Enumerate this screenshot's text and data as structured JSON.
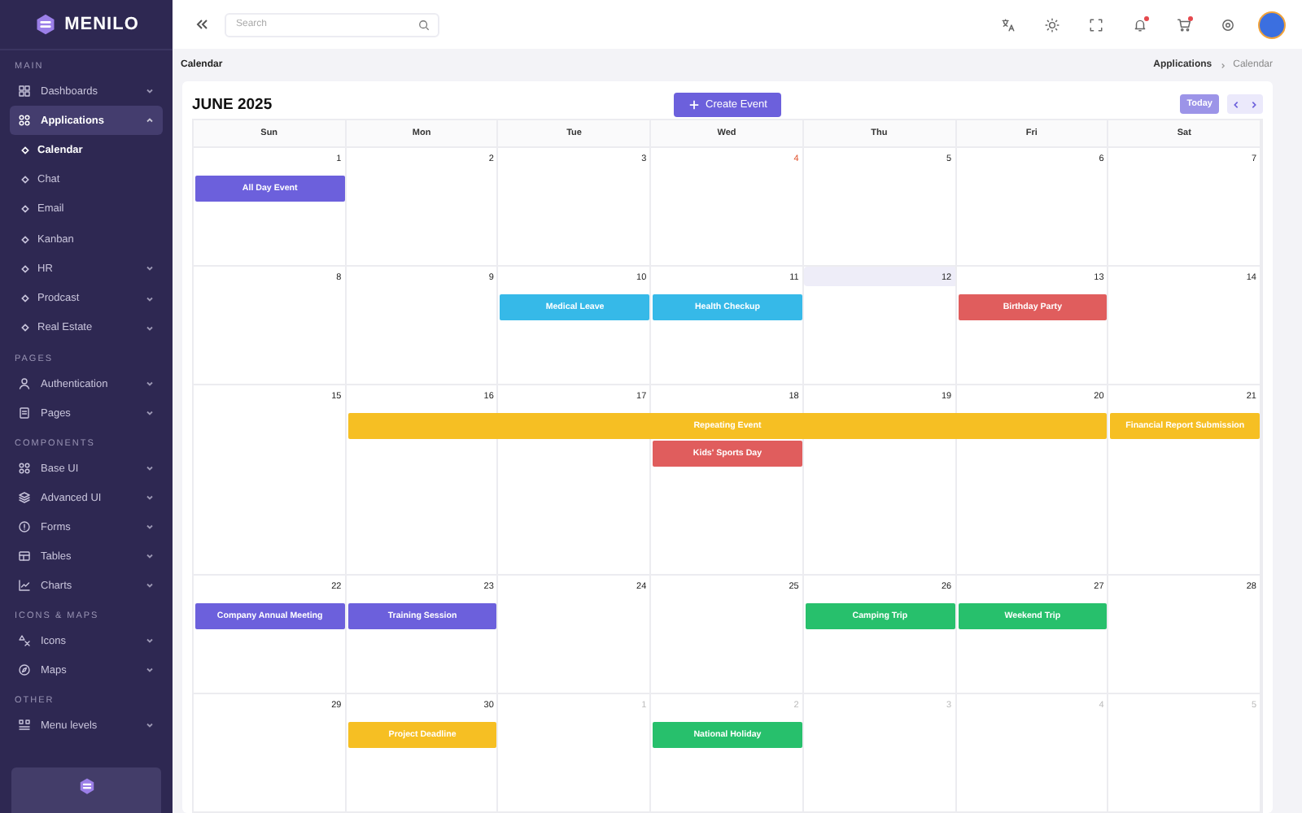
{
  "brand": {
    "name": "MENILO"
  },
  "sidebar": {
    "sections": [
      {
        "title": "MAIN",
        "items": [
          {
            "label": "Dashboards",
            "expandable": true,
            "expanded": false,
            "selected": false
          },
          {
            "label": "Applications",
            "expandable": true,
            "expanded": true,
            "selected": true,
            "children": [
              {
                "label": "Calendar",
                "selected": true,
                "expandable": false
              },
              {
                "label": "Chat",
                "selected": false,
                "expandable": false
              },
              {
                "label": "Email",
                "selected": false,
                "expandable": false
              },
              {
                "label": "Kanban",
                "selected": false,
                "expandable": false
              },
              {
                "label": "HR",
                "selected": false,
                "expandable": true
              },
              {
                "label": "Prodcast",
                "selected": false,
                "expandable": true
              },
              {
                "label": "Real Estate",
                "selected": false,
                "expandable": true
              }
            ]
          }
        ]
      },
      {
        "title": "PAGES",
        "items": [
          {
            "label": "Authentication",
            "expandable": true,
            "expanded": false,
            "selected": false
          },
          {
            "label": "Pages",
            "expandable": true,
            "expanded": false,
            "selected": false
          }
        ]
      },
      {
        "title": "COMPONENTS",
        "items": [
          {
            "label": "Base UI",
            "expandable": true,
            "expanded": false,
            "selected": false
          },
          {
            "label": "Advanced UI",
            "expandable": true,
            "expanded": false,
            "selected": false
          },
          {
            "label": "Forms",
            "expandable": true,
            "expanded": false,
            "selected": false
          },
          {
            "label": "Tables",
            "expandable": true,
            "expanded": false,
            "selected": false
          },
          {
            "label": "Charts",
            "expandable": true,
            "expanded": false,
            "selected": false
          }
        ]
      },
      {
        "title": "ICONS & MAPS",
        "items": [
          {
            "label": "Icons",
            "expandable": true,
            "expanded": false,
            "selected": false
          },
          {
            "label": "Maps",
            "expandable": true,
            "expanded": false,
            "selected": false
          }
        ]
      },
      {
        "title": "OTHER",
        "items": [
          {
            "label": "Menu levels",
            "expandable": true,
            "expanded": false,
            "selected": false
          }
        ]
      }
    ]
  },
  "header": {
    "search": {
      "placeholder": "Search"
    },
    "icons": [
      {
        "kind": "translate",
        "dot": false
      },
      {
        "kind": "sun",
        "dot": false
      },
      {
        "kind": "fullscreen",
        "dot": false
      },
      {
        "kind": "bell",
        "dot": true
      },
      {
        "kind": "cart",
        "dot": true
      },
      {
        "kind": "gear",
        "dot": false
      }
    ]
  },
  "page": {
    "title": "Calendar",
    "breadcrumb": [
      {
        "label": "Applications",
        "current": false
      },
      {
        "label": "Calendar",
        "current": true
      }
    ]
  },
  "calendar": {
    "title": "JUNE 2025",
    "create_button": "Create Event",
    "today_button": "Today",
    "weekdays": [
      "Sun",
      "Mon",
      "Tue",
      "Wed",
      "Thu",
      "Fri",
      "Sat"
    ],
    "weeks": [
      {
        "days": [
          {
            "label": "1",
            "events": [
              {
                "title": "All Day Event",
                "color": "#6c60dc"
              }
            ]
          },
          {
            "label": "2"
          },
          {
            "label": "3"
          },
          {
            "label": "4",
            "marked": true
          },
          {
            "label": "5"
          },
          {
            "label": "6"
          },
          {
            "label": "7"
          }
        ]
      },
      {
        "days": [
          {
            "label": "8"
          },
          {
            "label": "9"
          },
          {
            "label": "10",
            "events": [
              {
                "title": "Medical Leave",
                "color": "#36b9e8"
              }
            ]
          },
          {
            "label": "11",
            "events": [
              {
                "title": "Health Checkup",
                "color": "#36b9e8"
              }
            ]
          },
          {
            "label": "12",
            "today": true
          },
          {
            "label": "13",
            "events": [
              {
                "title": "Birthday Party",
                "color": "#e05d5d"
              }
            ]
          },
          {
            "label": "14"
          }
        ]
      },
      {
        "days": [
          {
            "label": "15"
          },
          {
            "label": "16",
            "events": [
              {
                "title": "Repeating Event",
                "color": "#f6bf23"
              }
            ]
          },
          {
            "label": "17",
            "events": [
              {
                "continued": true
              }
            ]
          },
          {
            "label": "18",
            "events": [
              {
                "continued": true
              },
              {
                "title": "Kids' Sports Day",
                "color": "#e05d5d"
              }
            ]
          },
          {
            "label": "19",
            "events": [
              {
                "continued": true
              }
            ]
          },
          {
            "label": "20",
            "events": [
              {
                "continued": true
              }
            ]
          },
          {
            "label": "21",
            "events": [
              {
                "title": "Financial Report Submission",
                "color": "#f6bf23"
              }
            ]
          }
        ]
      },
      {
        "days": [
          {
            "label": "22",
            "events": [
              {
                "title": "Company Annual Meeting",
                "color": "#6c60dc"
              }
            ]
          },
          {
            "label": "23",
            "events": [
              {
                "title": "Training Session",
                "color": "#6c60dc"
              }
            ]
          },
          {
            "label": "24"
          },
          {
            "label": "25"
          },
          {
            "label": "26",
            "events": [
              {
                "title": "Camping Trip",
                "color": "#27c06c"
              }
            ]
          },
          {
            "label": "27",
            "events": [
              {
                "title": "Weekend Trip",
                "color": "#27c06c"
              }
            ]
          },
          {
            "label": "28"
          }
        ]
      },
      {
        "days": [
          {
            "label": "29"
          },
          {
            "label": "30",
            "events": [
              {
                "title": "Project Deadline",
                "color": "#f6bf23"
              }
            ]
          },
          {
            "label": "1",
            "other_month": true
          },
          {
            "label": "2",
            "other_month": true,
            "events": [
              {
                "title": "National Holiday",
                "color": "#27c06c"
              }
            ]
          },
          {
            "label": "3",
            "other_month": true
          },
          {
            "label": "4",
            "other_month": true
          },
          {
            "label": "5",
            "other_month": true
          }
        ]
      }
    ]
  }
}
